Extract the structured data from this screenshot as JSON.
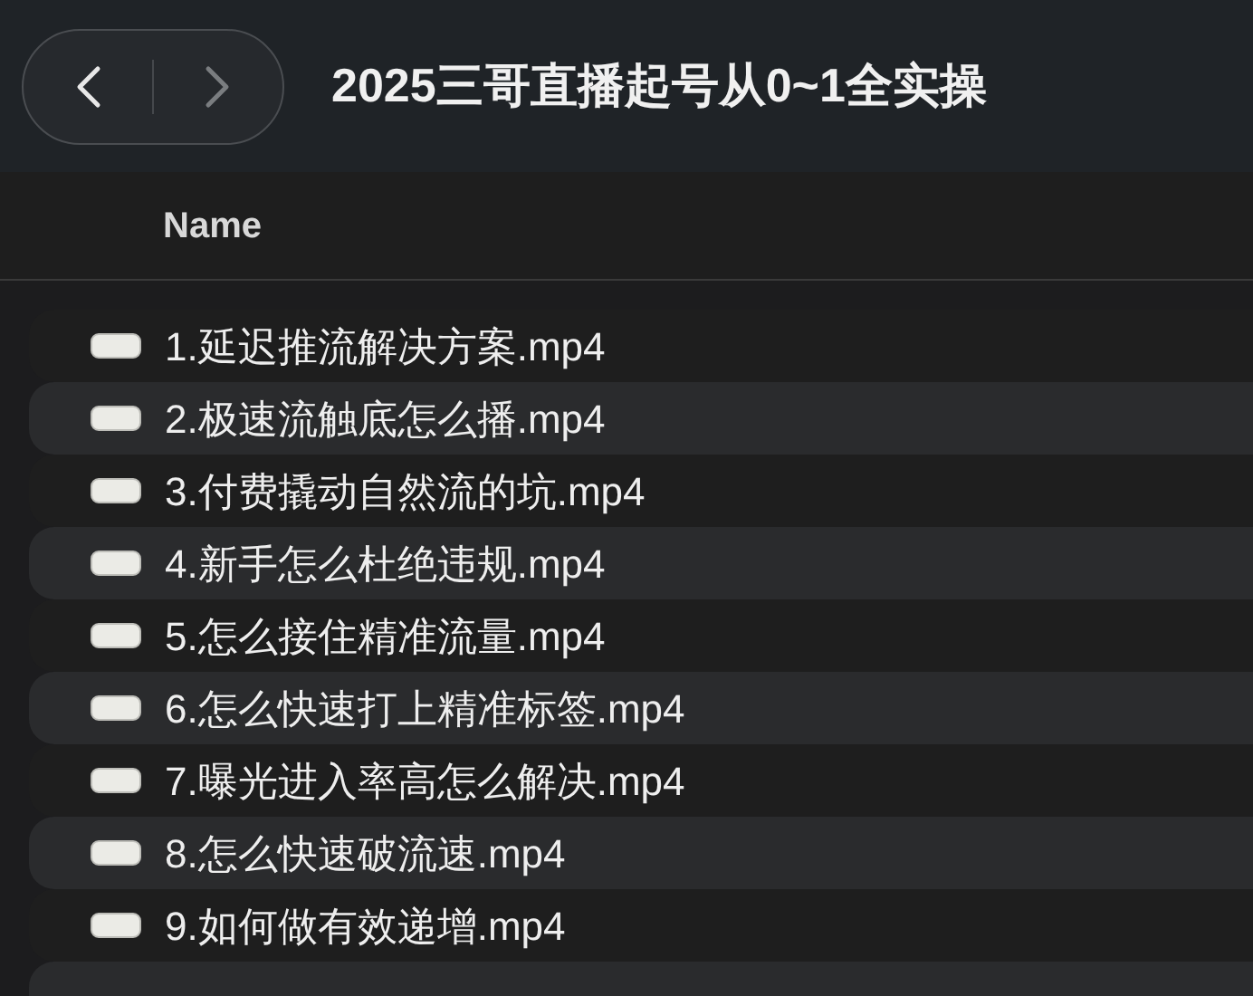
{
  "toolbar": {
    "back_button": {
      "disabled": false
    },
    "forward_button": {
      "disabled": true
    },
    "title": "2025三哥直播起号从0~1全实操"
  },
  "table": {
    "columns": [
      "Name"
    ],
    "rows": [
      {
        "name": "1.延迟推流解决方案.mp4"
      },
      {
        "name": "2.极速流触底怎么播.mp4"
      },
      {
        "name": "3.付费撬动自然流的坑.mp4"
      },
      {
        "name": "4.新手怎么杜绝违规.mp4"
      },
      {
        "name": "5.怎么接住精准流量.mp4"
      },
      {
        "name": "6.怎么快速打上精准标签.mp4"
      },
      {
        "name": "7.曝光进入率高怎么解决.mp4"
      },
      {
        "name": "8.怎么快速破流速.mp4"
      },
      {
        "name": "9.如何做有效递增.mp4"
      }
    ]
  }
}
